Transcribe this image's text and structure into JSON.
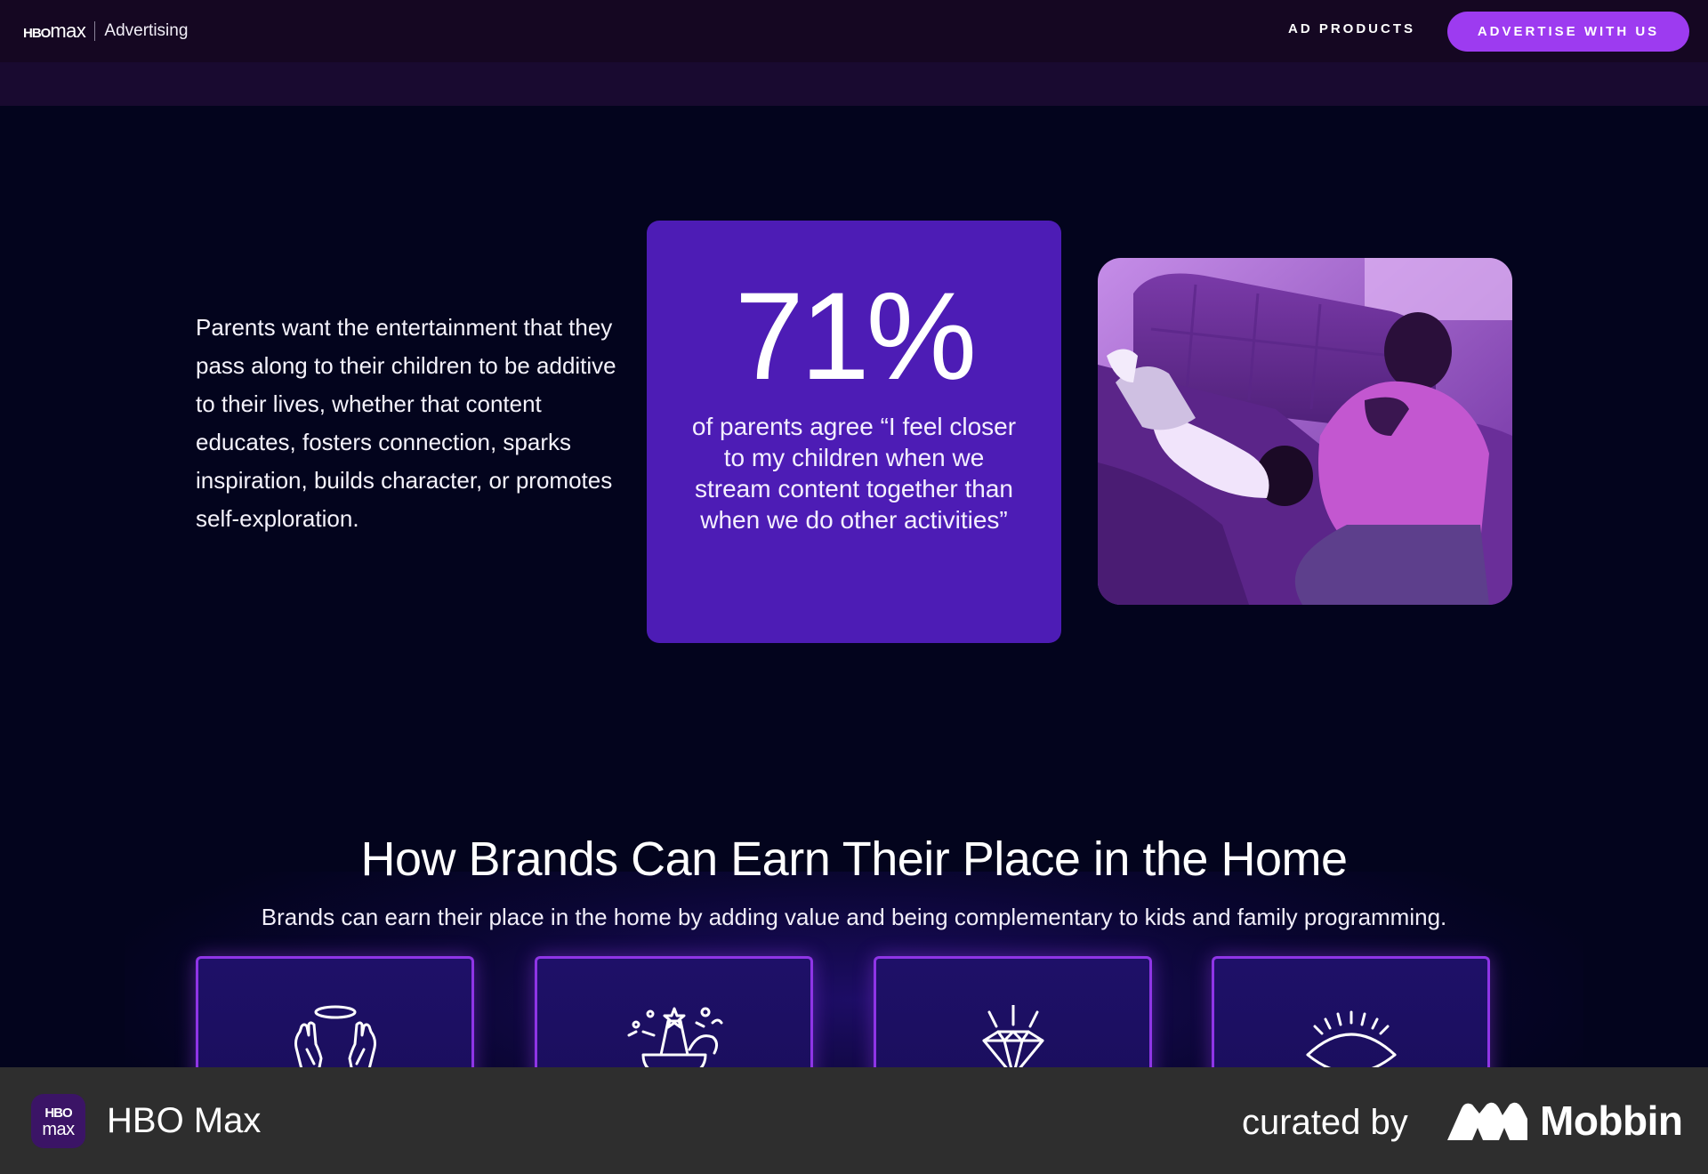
{
  "header": {
    "logo_hbo": "HBO",
    "logo_max": "max",
    "brand_label": "Advertising",
    "nav_link": "AD PRODUCTS",
    "cta_label": "ADVERTISE WITH US"
  },
  "stat_section": {
    "intro": "Parents want the entertainment that they pass along to their children to be additive to their lives, whether that content educates, fosters connection, sparks inspiration, builds character, or promotes self-exploration.",
    "stat_value": "71%",
    "stat_caption": "of parents agree “I feel closer to my children when we stream content together than when we do other activities”",
    "accent_color": "#4d1cb5"
  },
  "brands_section": {
    "title": "How Brands Can Earn Their Place in the Home",
    "subtitle": "Brands can earn their place in the home by adding value and being complementary to kids and family programming.",
    "tiles": [
      {
        "icon": "halo-hands-icon"
      },
      {
        "icon": "celebration-pot-icon"
      },
      {
        "icon": "diamond-icon"
      },
      {
        "icon": "eye-icon"
      }
    ]
  },
  "footer": {
    "app_icon_top": "HBO",
    "app_icon_bottom": "max",
    "app_name": "HBO Max",
    "curated_by": "curated by",
    "mobbin": "Mobbin"
  },
  "colors": {
    "background": "#03041d",
    "cta": "#9d3bf0",
    "tile_border": "#8f35e6",
    "footer": "#2e2e2e"
  }
}
